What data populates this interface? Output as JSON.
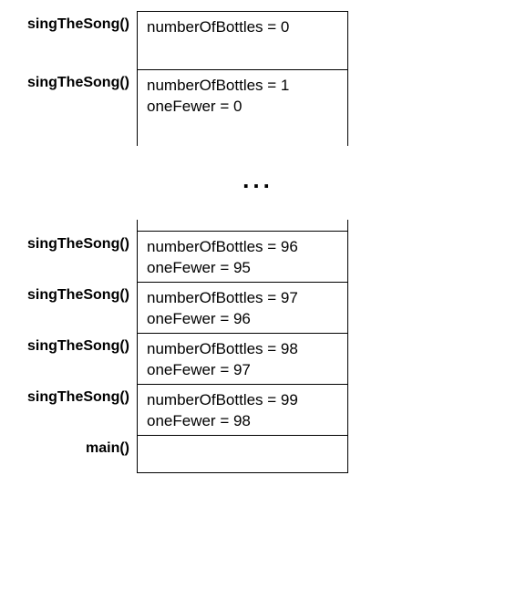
{
  "ellipsis": "...",
  "top_frames": [
    {
      "label": "singTheSong()",
      "line1": "numberOfBottles = 0",
      "line2": ""
    },
    {
      "label": "singTheSong()",
      "line1": "numberOfBottles = 1",
      "line2": "oneFewer = 0"
    }
  ],
  "bottom_frames": [
    {
      "label": "singTheSong()",
      "line1": "numberOfBottles = 96",
      "line2": "oneFewer = 95"
    },
    {
      "label": "singTheSong()",
      "line1": "numberOfBottles = 97",
      "line2": "oneFewer = 96"
    },
    {
      "label": "singTheSong()",
      "line1": "numberOfBottles = 98",
      "line2": "oneFewer = 97"
    },
    {
      "label": "singTheSong()",
      "line1": "numberOfBottles = 99",
      "line2": "oneFewer = 98"
    }
  ],
  "main_label": "main()"
}
